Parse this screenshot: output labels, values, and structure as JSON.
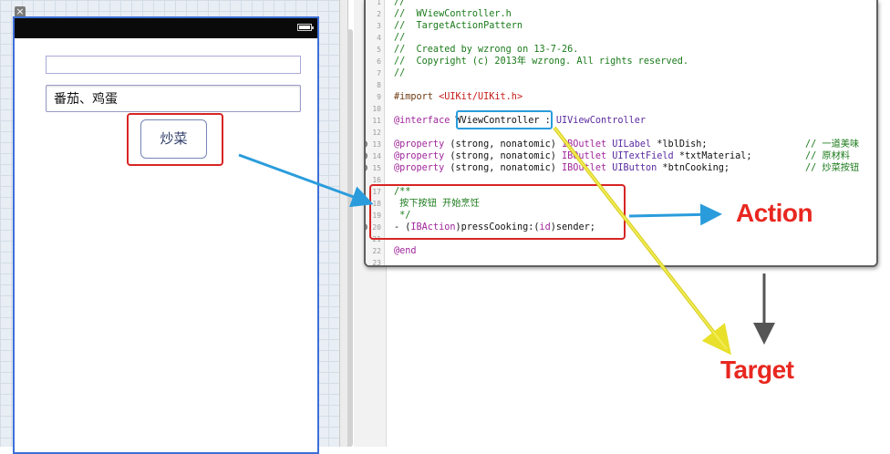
{
  "interface_builder": {
    "material_field_value": "番茄、鸡蛋",
    "cook_button_label": "炒菜"
  },
  "code_editor": {
    "lines": [
      {
        "n": "1",
        "text": "//"
      },
      {
        "n": "2",
        "text": "//  WViewController.h"
      },
      {
        "n": "3",
        "text": "//  TargetActionPattern"
      },
      {
        "n": "4",
        "text": "//"
      },
      {
        "n": "5",
        "text": "//  Created by wzrong on 13-7-26."
      },
      {
        "n": "6",
        "text": "//  Copyright (c) 2013年 wzrong. All rights reserved."
      },
      {
        "n": "7",
        "text": "//"
      },
      {
        "n": "8",
        "text": ""
      },
      {
        "n": "9",
        "import_kw": "#import ",
        "import_path": "<UIKit/UIKit.h>"
      },
      {
        "n": "10",
        "text": ""
      },
      {
        "n": "11",
        "kw": "@interface ",
        "class_name": "WViewController",
        "rest": " : ",
        "super": "UIViewController"
      },
      {
        "n": "12",
        "text": ""
      },
      {
        "n": "13",
        "kw": "@property ",
        "attrs": "(strong, nonatomic) ",
        "outlet": "IBOutlet ",
        "type": "UILabel",
        "decl": " *lblDish;",
        "comment": "// 一道美味"
      },
      {
        "n": "14",
        "kw": "@property ",
        "attrs": "(strong, nonatomic) ",
        "outlet": "IBOutlet ",
        "type": "UITextField",
        "decl": " *txtMaterial;",
        "comment": "// 原材料"
      },
      {
        "n": "15",
        "kw": "@property ",
        "attrs": "(strong, nonatomic) ",
        "outlet": "IBOutlet ",
        "type": "UIButton",
        "decl": " *btnCooking;",
        "comment": "// 炒菜按钮"
      },
      {
        "n": "16",
        "text": ""
      },
      {
        "n": "17",
        "text": "/**"
      },
      {
        "n": "18",
        "text": " 按下按钮 开始烹饪"
      },
      {
        "n": "19",
        "text": " */"
      },
      {
        "n": "20",
        "pre": "- (",
        "ibaction": "IBAction",
        "mid": ")pressCooking:(",
        "id": "id",
        "post": ")sender;"
      },
      {
        "n": "21",
        "text": ""
      },
      {
        "n": "22",
        "text": "@end"
      },
      {
        "n": "23",
        "text": ""
      }
    ]
  },
  "annotations": {
    "action_label": "Action",
    "target_label": "Target"
  },
  "colors": {
    "red_highlight": "#d82424",
    "blue_highlight": "#2a9cdc",
    "blue_arrow": "#2a9cdc",
    "yellow_arrow": "#e8e02a",
    "gray_arrow": "#555555",
    "annotation_text": "#e8271f",
    "comment_green": "#1a7a1a",
    "keyword_purple": "#a0269b",
    "string_red": "#c41a16"
  },
  "icons": [
    "close-icon",
    "battery-icon",
    "connection-dot-icon"
  ]
}
